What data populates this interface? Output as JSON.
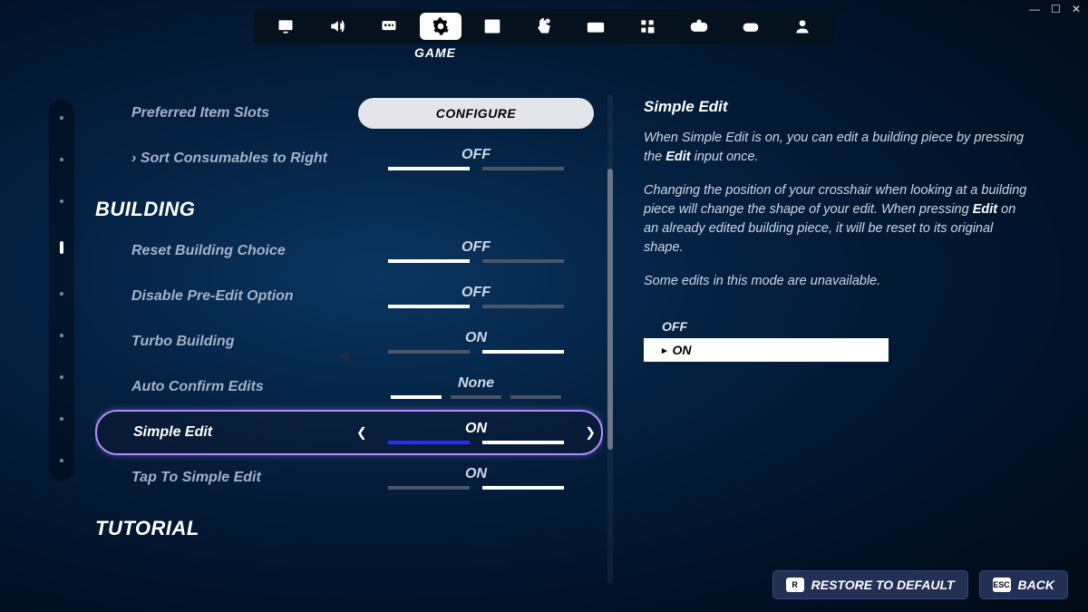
{
  "window": {
    "minimize": "—",
    "maximize": "☐",
    "close": "✕"
  },
  "tabs": {
    "active_index": 3,
    "active_label": "GAME"
  },
  "sections": {
    "building": "BUILDING",
    "tutorial": "TUTORIAL"
  },
  "settings": {
    "preferred_item_slots": {
      "label": "Preferred Item Slots",
      "button": "CONFIGURE"
    },
    "sort_consumables": {
      "label": "› Sort Consumables to Right",
      "value": "OFF"
    },
    "reset_building_choice": {
      "label": "Reset Building Choice",
      "value": "OFF"
    },
    "disable_pre_edit": {
      "label": "Disable Pre-Edit Option",
      "value": "OFF"
    },
    "turbo_building": {
      "label": "Turbo Building",
      "value": "ON"
    },
    "auto_confirm_edits": {
      "label": "Auto Confirm Edits",
      "value": "None"
    },
    "simple_edit": {
      "label": "Simple Edit",
      "value": "ON"
    },
    "tap_to_simple_edit": {
      "label": "Tap To Simple Edit",
      "value": "ON"
    }
  },
  "description": {
    "title": "Simple Edit",
    "p1a": "When Simple Edit is on, you can edit a building piece by pressing the ",
    "p1b": "Edit",
    "p1c": " input once.",
    "p2a": "Changing the position of your crosshair when looking at a building piece will change the shape of your edit. When pressing ",
    "p2b": "Edit",
    "p2c": " on an already edited building piece, it will be reset to its original shape.",
    "p3": "Some edits in this mode are unavailable.",
    "options": {
      "off": "OFF",
      "on": "ON"
    }
  },
  "footer": {
    "restore_key": "R",
    "restore": "RESTORE TO DEFAULT",
    "back_key": "ESC",
    "back": "BACK"
  }
}
